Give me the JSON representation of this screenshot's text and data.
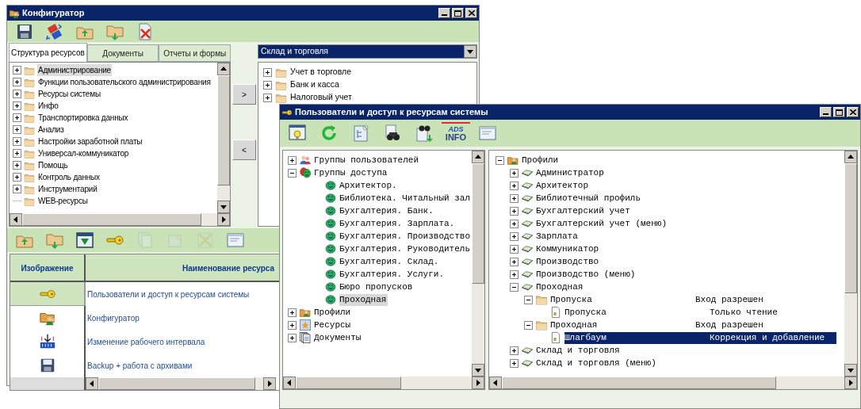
{
  "config_window": {
    "title": "Конфигуратор",
    "toolbar": [
      {
        "kind": "save"
      },
      {
        "kind": "swap"
      },
      {
        "kind": "folder_up"
      },
      {
        "kind": "folder_down"
      },
      {
        "kind": "delete_doc"
      }
    ],
    "tabs": [
      {
        "label": "Структура ресурсов",
        "selected": true
      },
      {
        "label": "Документы",
        "selected": false
      },
      {
        "label": "Отчеты и формы",
        "selected": false
      }
    ],
    "resource_tree": [
      {
        "label": "Администрирование",
        "expandable": true,
        "selected": true
      },
      {
        "label": "Функции пользовательского администрирования",
        "expandable": true,
        "selected": false
      },
      {
        "label": "Ресурсы системы",
        "expandable": true,
        "selected": false
      },
      {
        "label": "Инфо",
        "expandable": true,
        "selected": false
      },
      {
        "label": "Транспортировка данных",
        "expandable": true,
        "selected": false
      },
      {
        "label": "Анализ",
        "expandable": true,
        "selected": false
      },
      {
        "label": "Настройки заработной платы",
        "expandable": true,
        "selected": false
      },
      {
        "label": "Универсал-коммуникатор",
        "expandable": true,
        "selected": false
      },
      {
        "label": "Помощь",
        "expandable": true,
        "selected": false
      },
      {
        "label": "Контроль данных",
        "expandable": true,
        "selected": false
      },
      {
        "label": "Инструментарий",
        "expandable": true,
        "selected": false
      },
      {
        "label": "WEB-ресурсы",
        "expandable": false,
        "selected": false
      }
    ],
    "move_buttons": [
      ">",
      "<"
    ],
    "section_select": {
      "value": "Склад и торговля"
    },
    "section_tree": [
      {
        "label": "Учет в торговле"
      },
      {
        "label": "Банк и касса"
      },
      {
        "label": "Налоговый учет"
      }
    ],
    "bottom_toolbar": [
      {
        "kind": "folder_up",
        "disabled": false
      },
      {
        "kind": "folder_down",
        "disabled": false
      },
      {
        "kind": "module",
        "disabled": false
      },
      {
        "kind": "key",
        "disabled": false
      },
      {
        "kind": "doc_stack",
        "disabled": true
      },
      {
        "kind": "doc_edit",
        "disabled": true
      },
      {
        "kind": "tools",
        "disabled": true
      },
      {
        "kind": "window",
        "disabled": false
      }
    ],
    "table": {
      "columns": [
        "Изображение",
        "Наименование ресурса"
      ],
      "rows": [
        {
          "kind": "key",
          "name": "Пользователи и доступ к ресурсам системы",
          "selected": true
        },
        {
          "kind": "users_folder",
          "name": "Конфигуратор",
          "selected": false
        },
        {
          "kind": "interval",
          "name": "Изменение рабочего интервала",
          "selected": false
        },
        {
          "kind": "save",
          "name": "Backup + работа с архивами",
          "selected": false
        }
      ]
    }
  },
  "access_window": {
    "title": "Пользователи и доступ к ресурсам системы",
    "toolbar": [
      {
        "kind": "bulb_doc"
      },
      {
        "kind": "refresh"
      },
      {
        "kind": "tree_doc"
      },
      {
        "kind": "binoculars"
      },
      {
        "kind": "binoculars_down"
      },
      {
        "kind": "ads_info",
        "label_lines": [
          "ADS",
          "INFO"
        ]
      },
      {
        "kind": "window"
      }
    ],
    "groups_tree": [
      {
        "label": "Группы пользователей",
        "kind": "users",
        "expanded": false,
        "selected": false
      },
      {
        "label": "Группы доступа",
        "kind": "masks",
        "expanded": true,
        "selected": false,
        "children": [
          {
            "label": "Архитектор.",
            "kind": "mask",
            "selected": false
          },
          {
            "label": "Библиотека. Читальный зал",
            "kind": "mask",
            "selected": false
          },
          {
            "label": "Бухгалтерия. Банк.",
            "kind": "mask",
            "selected": false
          },
          {
            "label": "Бухгалтерия. Зарплата.",
            "kind": "mask",
            "selected": false
          },
          {
            "label": "Бухгалтерия. Производство",
            "kind": "mask",
            "selected": false
          },
          {
            "label": "Бухгалтерия. Руководитель",
            "kind": "mask",
            "selected": false
          },
          {
            "label": "Бухгалтерия. Склад.",
            "kind": "mask",
            "selected": false
          },
          {
            "label": "Бухгалтерия. Услуги.",
            "kind": "mask",
            "selected": false
          },
          {
            "label": "Бюро пропусков",
            "kind": "mask",
            "selected": false
          },
          {
            "label": "Проходная",
            "kind": "mask",
            "selected": true
          }
        ]
      },
      {
        "label": "Профили",
        "kind": "profiles",
        "expanded": false,
        "selected": false
      },
      {
        "label": "Ресурсы",
        "kind": "resources",
        "expanded": false,
        "selected": false
      },
      {
        "label": "Документы",
        "kind": "documents",
        "expanded": false,
        "selected": false
      }
    ],
    "profiles_tree": [
      {
        "label": "Профили",
        "kind": "profiles",
        "expanded": true,
        "selected": false,
        "children": [
          {
            "label": "Администратор",
            "kind": "profile",
            "expanded": false,
            "selected": false
          },
          {
            "label": "Архитектор",
            "kind": "profile",
            "expanded": false,
            "selected": false
          },
          {
            "label": "Библиотечный профиль",
            "kind": "profile",
            "expanded": false,
            "selected": false
          },
          {
            "label": "Бухгалтерский учет",
            "kind": "profile",
            "expanded": false,
            "selected": false
          },
          {
            "label": "Бухгалтерский учет (меню)",
            "kind": "profile",
            "expanded": false,
            "selected": false
          },
          {
            "label": "Зарплата",
            "kind": "profile",
            "expanded": false,
            "selected": false
          },
          {
            "label": "Коммуникатор",
            "kind": "profile",
            "expanded": false,
            "selected": false
          },
          {
            "label": "Производство",
            "kind": "profile",
            "expanded": false,
            "selected": false
          },
          {
            "label": "Производство (меню)",
            "kind": "profile",
            "expanded": false,
            "selected": false
          },
          {
            "label": "Проходная",
            "kind": "profile",
            "expanded": true,
            "selected": false,
            "children": [
              {
                "label": "Пропуска",
                "kind": "folder",
                "expanded": true,
                "selected": false,
                "access": "Вход разрешен",
                "children": [
                  {
                    "label": "Пропуска",
                    "kind": "doc",
                    "selected": false,
                    "access": "Только чтение"
                  }
                ]
              },
              {
                "label": "Проходная",
                "kind": "folder",
                "expanded": true,
                "selected": false,
                "access": "Вход разрешен",
                "children": [
                  {
                    "label": "Шлагбаум",
                    "kind": "doc",
                    "selected": true,
                    "access": "Коррекция и добавление"
                  }
                ]
              }
            ]
          },
          {
            "label": "Склад и торговля",
            "kind": "profile",
            "expanded": false,
            "selected": false
          },
          {
            "label": "Склад и торговля (меню)",
            "kind": "profile",
            "expanded": false,
            "selected": false
          }
        ]
      }
    ]
  }
}
